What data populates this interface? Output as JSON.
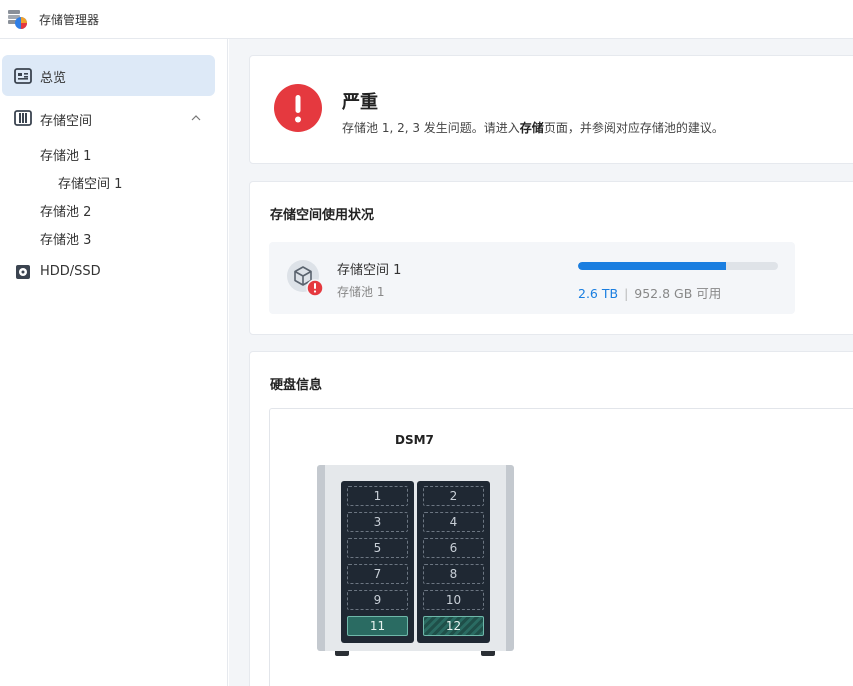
{
  "app": {
    "title": "存储管理器"
  },
  "sidebar": {
    "overview": "总览",
    "storage": "存储空间",
    "pools": [
      {
        "label": "存储池 1",
        "volumes": [
          "存储空间 1"
        ]
      },
      {
        "label": "存储池 2"
      },
      {
        "label": "存储池 3"
      }
    ],
    "hdd": "HDD/SSD"
  },
  "alert": {
    "title": "严重",
    "msg_pre": "存储池 1, 2, 3 发生问题。请进入",
    "msg_bold": "存储",
    "msg_post": "页面，并参阅对应存储池的建议。"
  },
  "usage": {
    "title": "存储空间使用状况",
    "volume": "存储空间 1",
    "pool": "存储池 1",
    "used": "2.6 TB",
    "separator": "|",
    "available": "952.8 GB 可用",
    "used_fraction": 0.74
  },
  "disks": {
    "title": "硬盘信息",
    "device": "DSM7",
    "slots": [
      "1",
      "2",
      "3",
      "4",
      "5",
      "6",
      "7",
      "8",
      "9",
      "10",
      "11",
      "12"
    ]
  },
  "colors": {
    "critical": "#e5393f",
    "accent": "#1a7ee0",
    "filled_slot": "#2a6b62"
  }
}
